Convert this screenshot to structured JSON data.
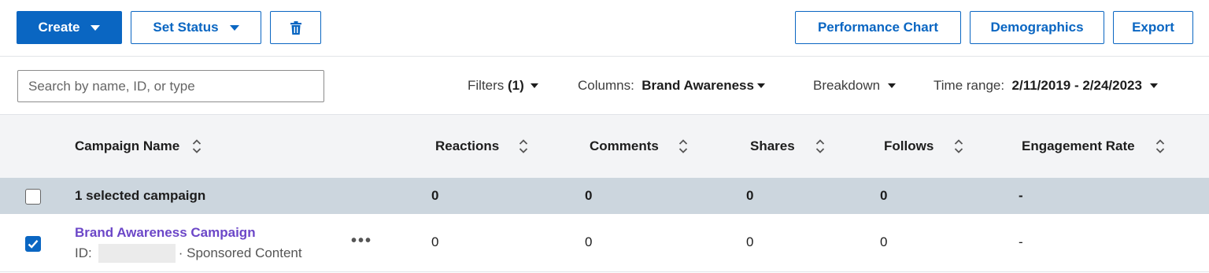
{
  "toolbar": {
    "create_label": "Create",
    "set_status_label": "Set Status",
    "delete_icon": "trash-icon",
    "performance_chart_label": "Performance Chart",
    "demographics_label": "Demographics",
    "export_label": "Export"
  },
  "filters": {
    "search_placeholder": "Search by name, ID, or type",
    "filters_label": "Filters",
    "filters_count": "(1)",
    "columns_label": "Columns:",
    "columns_value": "Brand Awareness",
    "breakdown_label": "Breakdown",
    "time_range_label": "Time range:",
    "time_range_value": "2/11/2019 - 2/24/2023"
  },
  "table": {
    "headers": {
      "campaign_name": "Campaign Name",
      "reactions": "Reactions",
      "comments": "Comments",
      "shares": "Shares",
      "follows": "Follows",
      "engagement_rate": "Engagement Rate"
    },
    "summary_row": {
      "label": "1 selected campaign",
      "reactions": "0",
      "comments": "0",
      "shares": "0",
      "follows": "0",
      "engagement_rate": "-"
    },
    "rows": [
      {
        "name": "Brand Awareness Campaign",
        "id_label": "ID:",
        "type": "· Sponsored Content",
        "reactions": "0",
        "comments": "0",
        "shares": "0",
        "follows": "0",
        "engagement_rate": "-",
        "menu": "•••",
        "checked": true
      }
    ]
  },
  "colors": {
    "primary": "#0a66c2",
    "link": "#6c47c8",
    "selected_row_bg": "#ccd6de",
    "header_bg": "#f3f4f6"
  }
}
